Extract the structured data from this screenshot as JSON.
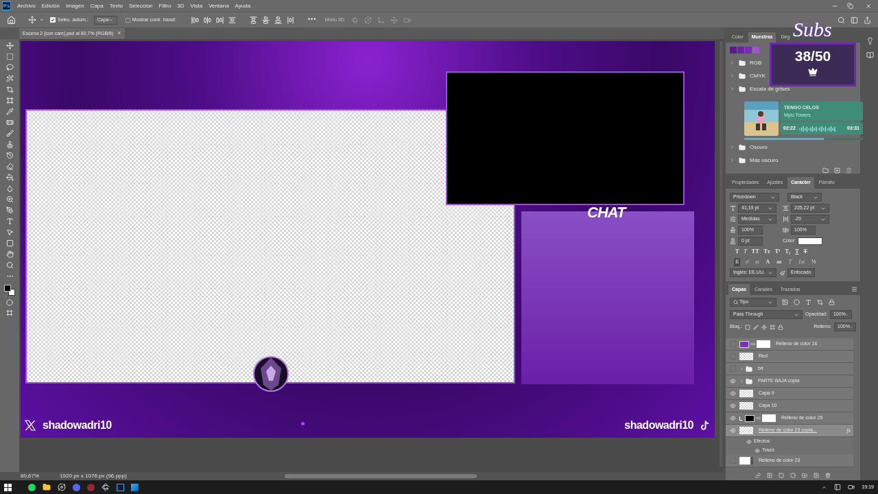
{
  "app_logo": "Ps",
  "menu": [
    "Archivo",
    "Edición",
    "Imagen",
    "Capa",
    "Texto",
    "Selección",
    "Filtro",
    "3D",
    "Vista",
    "Ventana",
    "Ayuda"
  ],
  "options": {
    "auto_select": {
      "label": "Selec. autom.:",
      "checked": true
    },
    "target": "Capa",
    "transform": {
      "label": "Mostrar contr. transf.",
      "checked": false
    },
    "more": "•••",
    "mode_3d": "Modo 3D:"
  },
  "document_tab": {
    "title": "Escena 2 (con cam).psd al 80,7% (RGB/8)",
    "close": "×"
  },
  "canvas": {
    "chat_label": "CHAT",
    "handles": [
      {
        "kind": "x",
        "name": "shadowadri10"
      },
      {
        "kind": "tiktok",
        "name": "shadowadri10"
      }
    ]
  },
  "swatches_panel": {
    "tabs": [
      {
        "label": "Color",
        "selected": false
      },
      {
        "label": "Muestras",
        "selected": true
      },
      {
        "label": "Deg",
        "selected": false
      }
    ],
    "swatches": [
      {
        "color": "#5b1a92"
      },
      {
        "color": "#6a22a6"
      },
      {
        "color": "#7a2cb8"
      },
      {
        "color": "#9a55cf"
      }
    ],
    "groups_top": [
      "RGB",
      "CMYK",
      "Escala de grises"
    ],
    "groups_bottom": [
      "Oscuro",
      "Más oscuro"
    ]
  },
  "properties_panel": {
    "tabs": [
      {
        "label": "Propiedades",
        "selected": false
      },
      {
        "label": "Ajustes",
        "selected": false
      },
      {
        "label": "Carácter",
        "selected": true
      },
      {
        "label": "Párrafo",
        "selected": false
      }
    ],
    "font_family": "Pricedown",
    "font_style": "Black",
    "size": "41,19 pt",
    "leading": "225,22 pt",
    "kerning": "Medidas",
    "tracking": "-20",
    "vertical_scale": "100%",
    "horizontal_scale": "100%",
    "baseline": "0 pt",
    "color_label": "Color:",
    "color": "#ffffff",
    "style_buttons": [
      {
        "glyph": "T",
        "kind": "bold"
      },
      {
        "glyph": "T",
        "kind": "italic"
      },
      {
        "glyph": "TT",
        "kind": "caps"
      },
      {
        "glyph": "Tт",
        "kind": "smallcaps"
      },
      {
        "glyph": "T¹",
        "kind": "super"
      },
      {
        "glyph": "T₁",
        "kind": "sub"
      },
      {
        "glyph": "T",
        "kind": "underline"
      },
      {
        "glyph": "T",
        "kind": "strike"
      }
    ],
    "opentype_buttons": [
      {
        "glyph": "fi",
        "selected": true,
        "disabled": false
      },
      {
        "glyph": "ơ",
        "selected": false,
        "disabled": true
      },
      {
        "glyph": "st",
        "selected": false,
        "disabled": true
      },
      {
        "glyph": "A",
        "selected": false,
        "disabled": false
      },
      {
        "glyph": "aa",
        "selected": false,
        "disabled": false
      },
      {
        "glyph": "T",
        "selected": false,
        "disabled": true
      },
      {
        "glyph": "1st",
        "selected": false,
        "disabled": true
      },
      {
        "glyph": "½",
        "selected": false,
        "disabled": false
      }
    ],
    "language": "Inglés: EE.UU.",
    "antialias": "Enfocado"
  },
  "layers_panel": {
    "tabs": [
      {
        "label": "Capas",
        "selected": true
      },
      {
        "label": "Canales",
        "selected": false
      },
      {
        "label": "Trazados",
        "selected": false
      }
    ],
    "filter": "Tipo",
    "blend": "Pass Through",
    "opacity_label": "Opacidad:",
    "opacity": "100%",
    "lock_label": "Bloq.:",
    "fill_label": "Relleno:",
    "fill": "100%",
    "layers": [
      {
        "name": "Relleno de color 16",
        "kind": "fill",
        "color": "#7b2fbf",
        "visible": false,
        "selected": false,
        "clipped": false
      },
      {
        "name": "Red",
        "kind": "pixel",
        "visible": false,
        "selected": false,
        "clipped": false
      },
      {
        "name": "txt",
        "kind": "group",
        "visible": false,
        "selected": false,
        "clipped": false
      },
      {
        "name": "PARTE BAJA copia",
        "kind": "group",
        "visible": true,
        "selected": false,
        "clipped": false
      },
      {
        "name": "Capa 9",
        "kind": "pixel",
        "visible": true,
        "selected": false,
        "clipped": false
      },
      {
        "name": "Capa 10",
        "kind": "pixel",
        "visible": true,
        "selected": false,
        "clipped": false
      },
      {
        "name": "Relleno de color 25",
        "kind": "fill",
        "color": "#000000",
        "visible": true,
        "selected": false,
        "clipped": true
      },
      {
        "name": "Relleno de color 23 copia...",
        "kind": "pixel",
        "visible": true,
        "selected": true,
        "clipped": false,
        "fx_label": "fx",
        "effects_label": "Efectos",
        "effects": [
          "Trazo"
        ]
      },
      {
        "name": "Relleno de color 23",
        "kind": "shape",
        "visible": false,
        "selected": false,
        "clipped": false
      }
    ]
  },
  "status": {
    "zoom": "80,67%",
    "info": "1920 px x 1076 px (96 ppp)"
  },
  "overlays": {
    "subs": {
      "title": "Subs",
      "count": "38/50"
    },
    "song": {
      "title": "TENGO CELOS",
      "artist": "Mylo Towers",
      "elapsed": "02:22",
      "total": "03:31",
      "level": 0.67
    }
  },
  "taskbar": {
    "time": "19:19"
  }
}
